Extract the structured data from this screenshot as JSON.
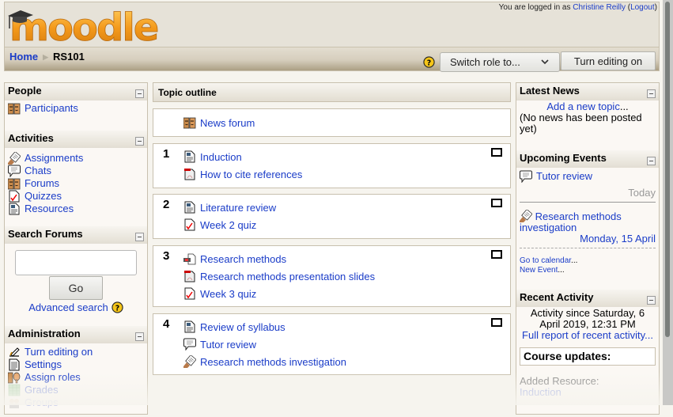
{
  "header": {
    "logo_text": "moodle",
    "login_prefix": "You are logged in as ",
    "user_name": "Christine Reilly",
    "logout_label": "Logout"
  },
  "navbar": {
    "breadcrumb": [
      "Home",
      "RS101"
    ],
    "switch_role_label": "Switch role to...",
    "edit_button_label": "Turn editing on"
  },
  "left": {
    "people": {
      "title": "People",
      "items": [
        {
          "label": "Participants",
          "icon": "participants-icon"
        }
      ]
    },
    "activities": {
      "title": "Activities",
      "items": [
        {
          "label": "Assignments",
          "icon": "assignment-icon"
        },
        {
          "label": "Chats",
          "icon": "chat-icon"
        },
        {
          "label": "Forums",
          "icon": "forum-icon"
        },
        {
          "label": "Quizzes",
          "icon": "quiz-icon"
        },
        {
          "label": "Resources",
          "icon": "resource-icon"
        }
      ]
    },
    "search": {
      "title": "Search Forums",
      "input_value": "",
      "go_label": "Go",
      "advanced_label": "Advanced search"
    },
    "admin": {
      "title": "Administration",
      "items": [
        {
          "label": "Turn editing on",
          "icon": "edit-icon"
        },
        {
          "label": "Settings",
          "icon": "settings-icon"
        },
        {
          "label": "Assign roles",
          "icon": "roles-icon"
        },
        {
          "label": "Grades",
          "icon": "grades-icon"
        },
        {
          "label": "Groups",
          "icon": "groups-icon"
        }
      ]
    }
  },
  "center": {
    "title": "Topic outline",
    "section0": [
      {
        "label": "News forum",
        "icon": "forum-icon"
      }
    ],
    "sections": [
      {
        "num": "1",
        "items": [
          {
            "label": "Induction",
            "icon": "resource-icon"
          },
          {
            "label": "How to cite references",
            "icon": "pdf-icon"
          }
        ]
      },
      {
        "num": "2",
        "items": [
          {
            "label": "Literature review",
            "icon": "resource-icon"
          },
          {
            "label": "Week 2 quiz",
            "icon": "quiz-icon"
          }
        ]
      },
      {
        "num": "3",
        "items": [
          {
            "label": "Research methods",
            "icon": "media-icon"
          },
          {
            "label": "Research methods presentation slides",
            "icon": "pdf-icon"
          },
          {
            "label": "Week 3 quiz",
            "icon": "quiz-icon"
          }
        ]
      },
      {
        "num": "4",
        "items": [
          {
            "label": "Review of syllabus",
            "icon": "resource-icon"
          },
          {
            "label": "Tutor review",
            "icon": "chat-icon"
          },
          {
            "label": "Research methods investigation",
            "icon": "assignment-icon"
          }
        ]
      }
    ]
  },
  "right": {
    "news": {
      "title": "Latest News",
      "add_topic": "Add a new topic",
      "add_topic_suffix": "...",
      "empty": "(No news has been posted yet)"
    },
    "events": {
      "title": "Upcoming Events",
      "items": [
        {
          "label": "Tutor review",
          "icon": "chat-icon",
          "date": "Today"
        },
        {
          "label": "Research methods investigation",
          "icon": "assignment-icon",
          "date": "Monday, 15 April"
        }
      ],
      "calendar_link": "Go to calendar",
      "new_event_link": "New Event",
      "ellipsis": "..."
    },
    "recent": {
      "title": "Recent Activity",
      "since": "Activity since Saturday, 6 April 2019, 12:31 PM",
      "full_report": "Full report of recent activity...",
      "course_updates": "Course updates:",
      "added": "Added Resource:",
      "added_item": "Induction"
    }
  },
  "colors": {
    "link": "#1a3cc8",
    "background": "#f6f4ee",
    "block_bg": "#fbf8f4",
    "border": "#c8c0ae",
    "logo_orange": "#f49a1c"
  }
}
